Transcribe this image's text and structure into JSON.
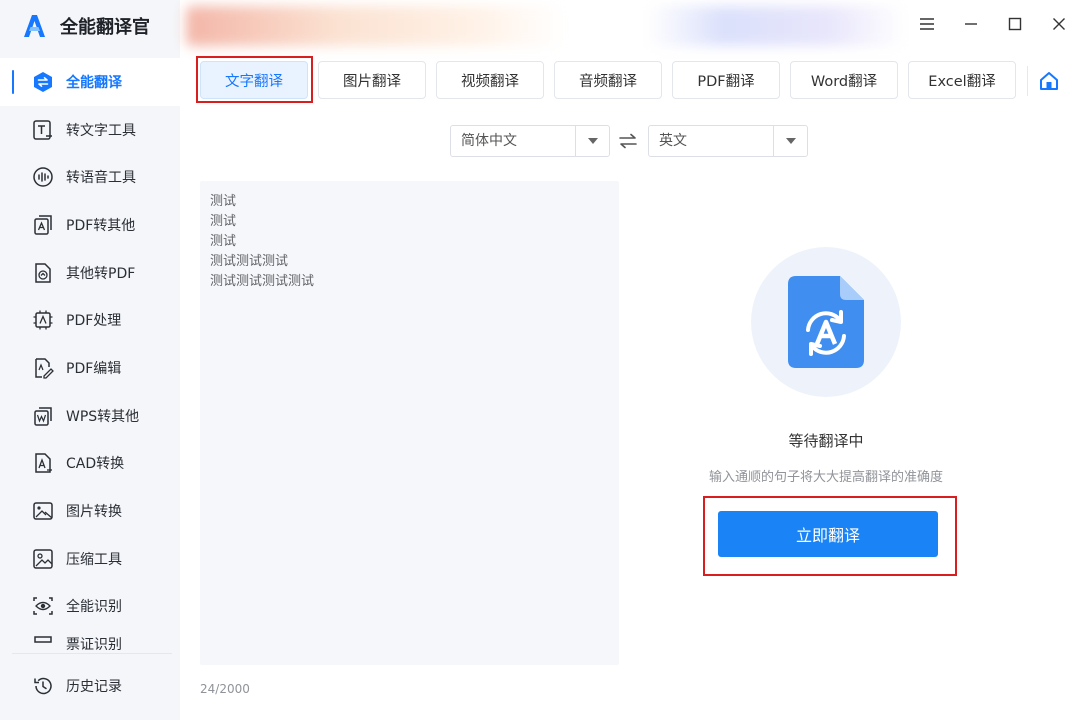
{
  "app": {
    "name": "全能翻译官"
  },
  "sidebar": {
    "items": [
      {
        "label": "全能翻译",
        "icon": "translate-swap-icon",
        "active": true
      },
      {
        "label": "转文字工具",
        "icon": "text-tool-icon"
      },
      {
        "label": "转语音工具",
        "icon": "voice-wave-icon"
      },
      {
        "label": "PDF转其他",
        "icon": "pdf-export-icon"
      },
      {
        "label": "其他转PDF",
        "icon": "to-pdf-icon"
      },
      {
        "label": "PDF处理",
        "icon": "pdf-process-icon"
      },
      {
        "label": "PDF编辑",
        "icon": "pdf-edit-icon"
      },
      {
        "label": "WPS转其他",
        "icon": "wps-icon"
      },
      {
        "label": "CAD转换",
        "icon": "cad-icon"
      },
      {
        "label": "图片转换",
        "icon": "image-convert-icon"
      },
      {
        "label": "压缩工具",
        "icon": "compress-icon"
      },
      {
        "label": "全能识别",
        "icon": "eye-scan-icon"
      },
      {
        "label": "票证识别",
        "icon": "ticket-icon"
      }
    ],
    "history": {
      "label": "历史记录",
      "icon": "history-icon"
    }
  },
  "tabs": [
    {
      "label": "文字翻译",
      "active": true
    },
    {
      "label": "图片翻译"
    },
    {
      "label": "视频翻译"
    },
    {
      "label": "音频翻译"
    },
    {
      "label": "PDF翻译"
    },
    {
      "label": "Word翻译"
    },
    {
      "label": "Excel翻译"
    }
  ],
  "language": {
    "source": "简体中文",
    "target": "英文"
  },
  "editor": {
    "text": "测试\n测试\n测试\n测试测试测试\n测试测试测试测试",
    "counter": "24/2000"
  },
  "result": {
    "status": "等待翻译中",
    "hint": "输入通顺的句子将大大提高翻译的准确度",
    "button": "立即翻译"
  },
  "colors": {
    "accent": "#1677ff",
    "button": "#1a84f7",
    "highlight": "#d81e1e"
  }
}
